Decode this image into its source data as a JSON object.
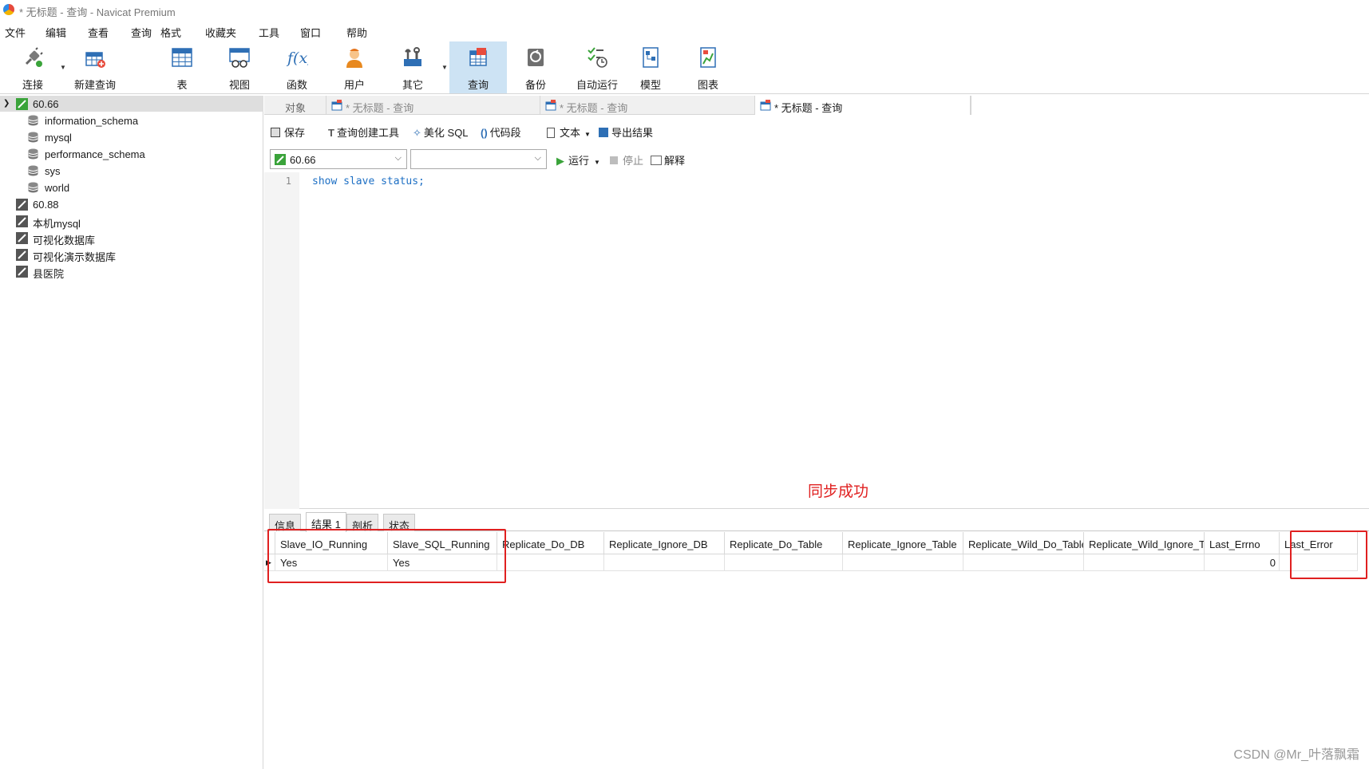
{
  "window": {
    "title": "* 无标题 - 查询 - Navicat Premium"
  },
  "menubar": [
    "文件",
    "编辑",
    "查看",
    "查询",
    "格式",
    "收藏夹",
    "工具",
    "窗口",
    "帮助"
  ],
  "toolbar": {
    "connect": "连接",
    "new_query": "新建查询",
    "table": "表",
    "view": "视图",
    "function": "函数",
    "user": "用户",
    "other": "其它",
    "query": "查询",
    "backup": "备份",
    "automation": "自动运行",
    "model": "模型",
    "chart": "图表"
  },
  "sidebar": {
    "connection": "60.66",
    "databases": [
      "information_schema",
      "mysql",
      "performance_schema",
      "sys",
      "world"
    ],
    "other_connections": [
      "60.88",
      "本机mysql",
      "可视化数据库",
      "可视化演示数据库",
      "县医院"
    ]
  },
  "tabs": {
    "objects": "对象",
    "tab1": "* 无标题 - 查询",
    "tab2": "* 无标题 - 查询",
    "tab3": "* 无标题 - 查询"
  },
  "query_toolbar": {
    "save": "保存",
    "builder": "查询创建工具",
    "beautify": "美化 SQL",
    "snippet": "代码段",
    "text": "文本",
    "export": "导出结果",
    "connection_value": "60.66",
    "database_value": "",
    "run": "运行",
    "stop": "停止",
    "explain": "解释"
  },
  "editor": {
    "line_number": "1",
    "code": "show slave status;"
  },
  "annotation": "同步成功",
  "result_tabs": [
    "信息",
    "结果 1",
    "剖析",
    "状态"
  ],
  "grid": {
    "columns": [
      "Slave_IO_Running",
      "Slave_SQL_Running",
      "Replicate_Do_DB",
      "Replicate_Ignore_DB",
      "Replicate_Do_Table",
      "Replicate_Ignore_Table",
      "Replicate_Wild_Do_Table",
      "Replicate_Wild_Ignore_T",
      "Last_Errno",
      "Last_Error"
    ],
    "row": [
      "Yes",
      "Yes",
      "",
      "",
      "",
      "",
      "",
      "",
      "0",
      ""
    ]
  },
  "watermark": "CSDN @Mr_叶落飘霜",
  "colors": {
    "highlight": "#e02020",
    "accent": "#cde3f4",
    "code": "#1d6fc4"
  }
}
